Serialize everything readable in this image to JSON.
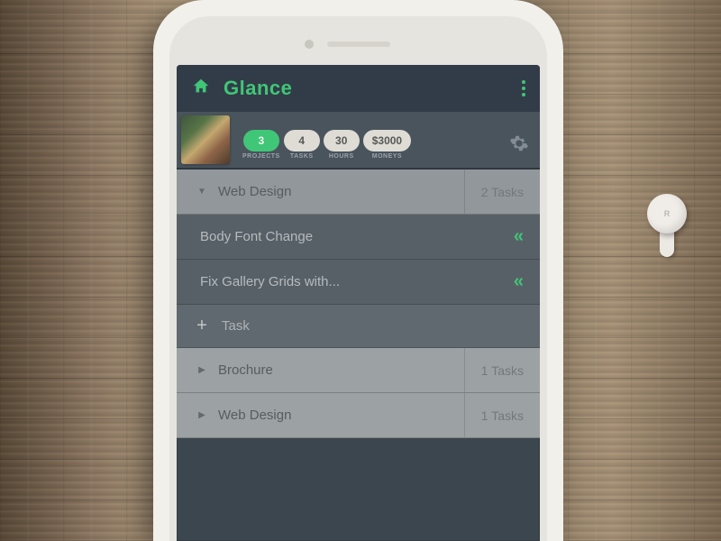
{
  "earbud_marker": "R",
  "header": {
    "title": "Glance"
  },
  "stats": [
    {
      "value": "3",
      "label": "PROJECTS",
      "active": true
    },
    {
      "value": "4",
      "label": "TASKS",
      "active": false
    },
    {
      "value": "30",
      "label": "HOURS",
      "active": false
    },
    {
      "value": "$3000",
      "label": "MONEYS",
      "active": false
    }
  ],
  "expanded_project": {
    "name": "Web Design",
    "count": "2 Tasks"
  },
  "tasks": [
    {
      "name": "Body Font Change"
    },
    {
      "name": "Fix Gallery Grids with..."
    }
  ],
  "add_label": "Task",
  "collapsed_projects": [
    {
      "name": "Brochure",
      "count": "1 Tasks"
    },
    {
      "name": "Web Design",
      "count": "1 Tasks"
    }
  ],
  "colors": {
    "accent": "#2ecc71"
  }
}
